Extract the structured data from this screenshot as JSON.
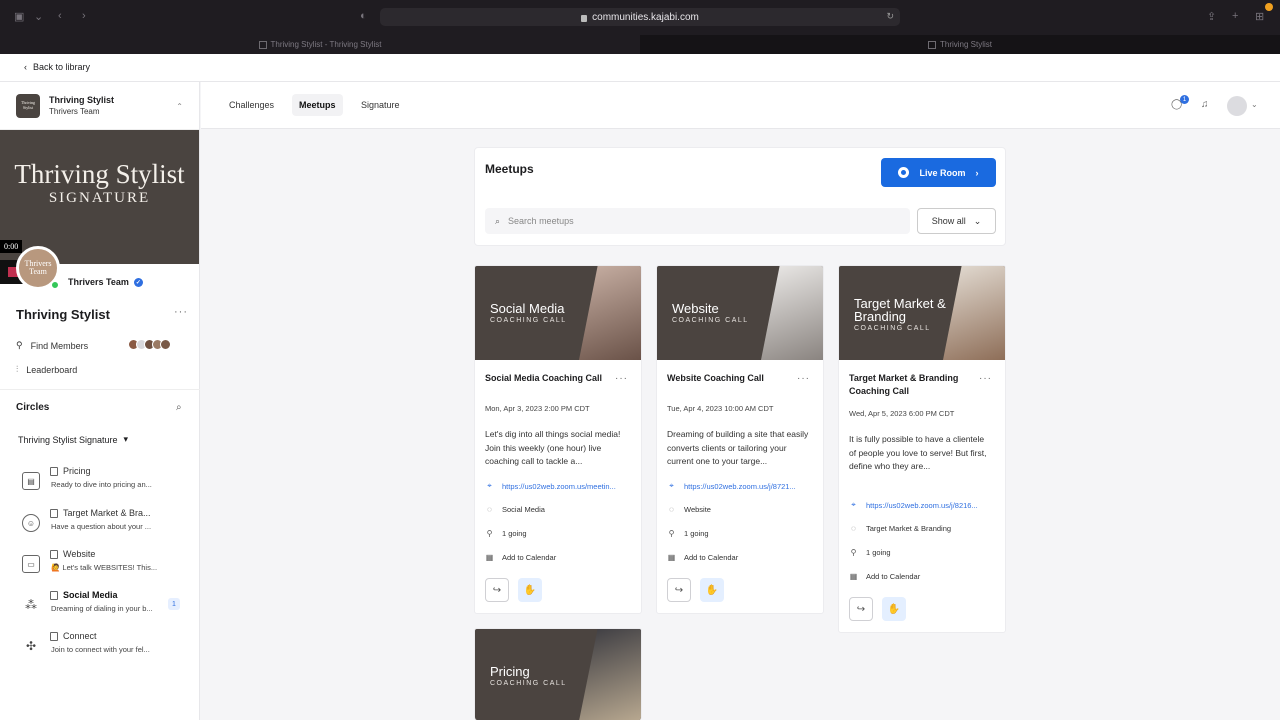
{
  "browser": {
    "url": "communities.kajabi.com",
    "tabs": [
      "Thriving Stylist - Thriving Stylist",
      "Thriving Stylist"
    ]
  },
  "header": {
    "back_label": "Back to library"
  },
  "sidebar": {
    "community_name": "Thriving Stylist",
    "community_team": "Thrivers Team",
    "logo_text": "Thriving Stylist",
    "banner_line1": "Thriving Stylist",
    "banner_line2": "SIGNATURE",
    "video_time": "0:00",
    "profile_avatar_text": "Thrivers Team",
    "profile_name": "Thrivers Team",
    "title": "Thriving Stylist",
    "links": [
      "Find Members",
      "Leaderboard"
    ],
    "circles_title": "Circles",
    "circles_filter": "Thriving Stylist Signature",
    "circles": [
      {
        "name": "Pricing",
        "sub": "Ready to dive into pricing an..."
      },
      {
        "name": "Target Market & Bra...",
        "sub": "Have a question about your ..."
      },
      {
        "name": "Website",
        "sub": "🙋 Let's talk WEBSITES! This..."
      },
      {
        "name": "Social Media",
        "sub": "Dreaming of dialing in your b...",
        "badge": "1"
      },
      {
        "name": "Connect",
        "sub": "Join to connect with your fel..."
      }
    ]
  },
  "topnav": {
    "tabs": [
      "Challenges",
      "Meetups",
      "Signature"
    ],
    "active_tab": "Meetups",
    "chat_badge": "1"
  },
  "meetups": {
    "title": "Meetups",
    "live_button": "Live Room",
    "search_placeholder": "Search meetups",
    "filter_label": "Show all",
    "cards": [
      {
        "image_title": "Social Media",
        "image_sub": "COACHING CALL",
        "title": "Social Media Coaching Call",
        "date": "Mon, Apr 3, 2023 2:00 PM CDT",
        "description": "Let's dig into all things social media! Join this weekly (one hour) live coaching call to tackle a...",
        "link": "https://us02web.zoom.us/meetin...",
        "circle": "Social Media",
        "going": "1 going",
        "calendar": "Add to Calendar"
      },
      {
        "image_title": "Website",
        "image_sub": "COACHING CALL",
        "title": "Website Coaching Call",
        "date": "Tue, Apr 4, 2023 10:00 AM CDT",
        "description": "Dreaming of building a site that easily converts clients or tailoring your current one to your targe...",
        "link": "https://us02web.zoom.us/j/8721...",
        "circle": "Website",
        "going": "1 going",
        "calendar": "Add to Calendar"
      },
      {
        "image_title": "Target Market & Branding",
        "image_sub": "COACHING CALL",
        "title": "Target Market & Branding Coaching Call",
        "date": "Wed, Apr 5, 2023 6:00 PM CDT",
        "description": "It is fully possible to have a clientele of people you love to serve! But first, define who they are...",
        "link": "https://us02web.zoom.us/j/8216...",
        "circle": "Target Market & Branding",
        "going": "1 going",
        "calendar": "Add to Calendar"
      },
      {
        "image_title": "Pricing",
        "image_sub": "COACHING CALL"
      }
    ]
  }
}
